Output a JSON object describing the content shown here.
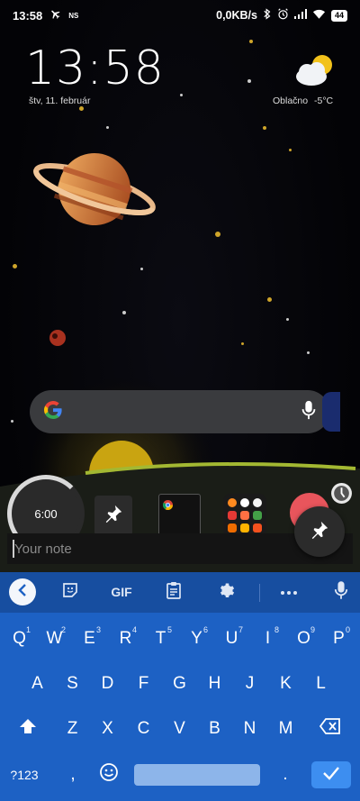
{
  "status_bar": {
    "time": "13:58",
    "ns_label": "NS",
    "speed": "0,0KB/s",
    "battery": "44"
  },
  "clock_widget": {
    "time": "13:58",
    "date": "štv, 11. február",
    "weather_condition": "Oblačno",
    "temperature": "-5°C"
  },
  "search_bar": {
    "logo": "G"
  },
  "widgets": {
    "timer_label": "6:00"
  },
  "note": {
    "placeholder": "Your note"
  },
  "keyboard": {
    "toolbar": {
      "gif_label": "GIF"
    },
    "row1": [
      "Q",
      "W",
      "E",
      "R",
      "T",
      "Y",
      "U",
      "I",
      "O",
      "P"
    ],
    "row1_hints": [
      "1",
      "2",
      "3",
      "4",
      "5",
      "6",
      "7",
      "8",
      "9",
      "0"
    ],
    "row2": [
      "A",
      "S",
      "D",
      "F",
      "G",
      "H",
      "J",
      "K",
      "L"
    ],
    "row3": [
      "Z",
      "X",
      "C",
      "V",
      "B",
      "N",
      "M"
    ],
    "symbols_key": "?123",
    "comma_key": ",",
    "period_key": "."
  },
  "colors": {
    "keyboard_bg": "#1d61c4",
    "toolbar_bg": "#174ea0",
    "search_bg": "#3a3b3e",
    "enter_key": "#3d8ef0",
    "sun": "#c9a411",
    "planet_orange": "#d8873a"
  },
  "icons": [
    "airplane-icon",
    "bluetooth-icon",
    "alarm-icon",
    "signal-icon",
    "wifi-icon",
    "cloud-sun-icon",
    "google-g-icon",
    "mic-icon",
    "pin-icon",
    "chrome-icon",
    "clock-icon",
    "back-icon",
    "sticker-icon",
    "clipboard-icon",
    "gear-icon",
    "more-icon",
    "shift-icon",
    "backspace-icon",
    "emoji-icon",
    "check-icon"
  ]
}
